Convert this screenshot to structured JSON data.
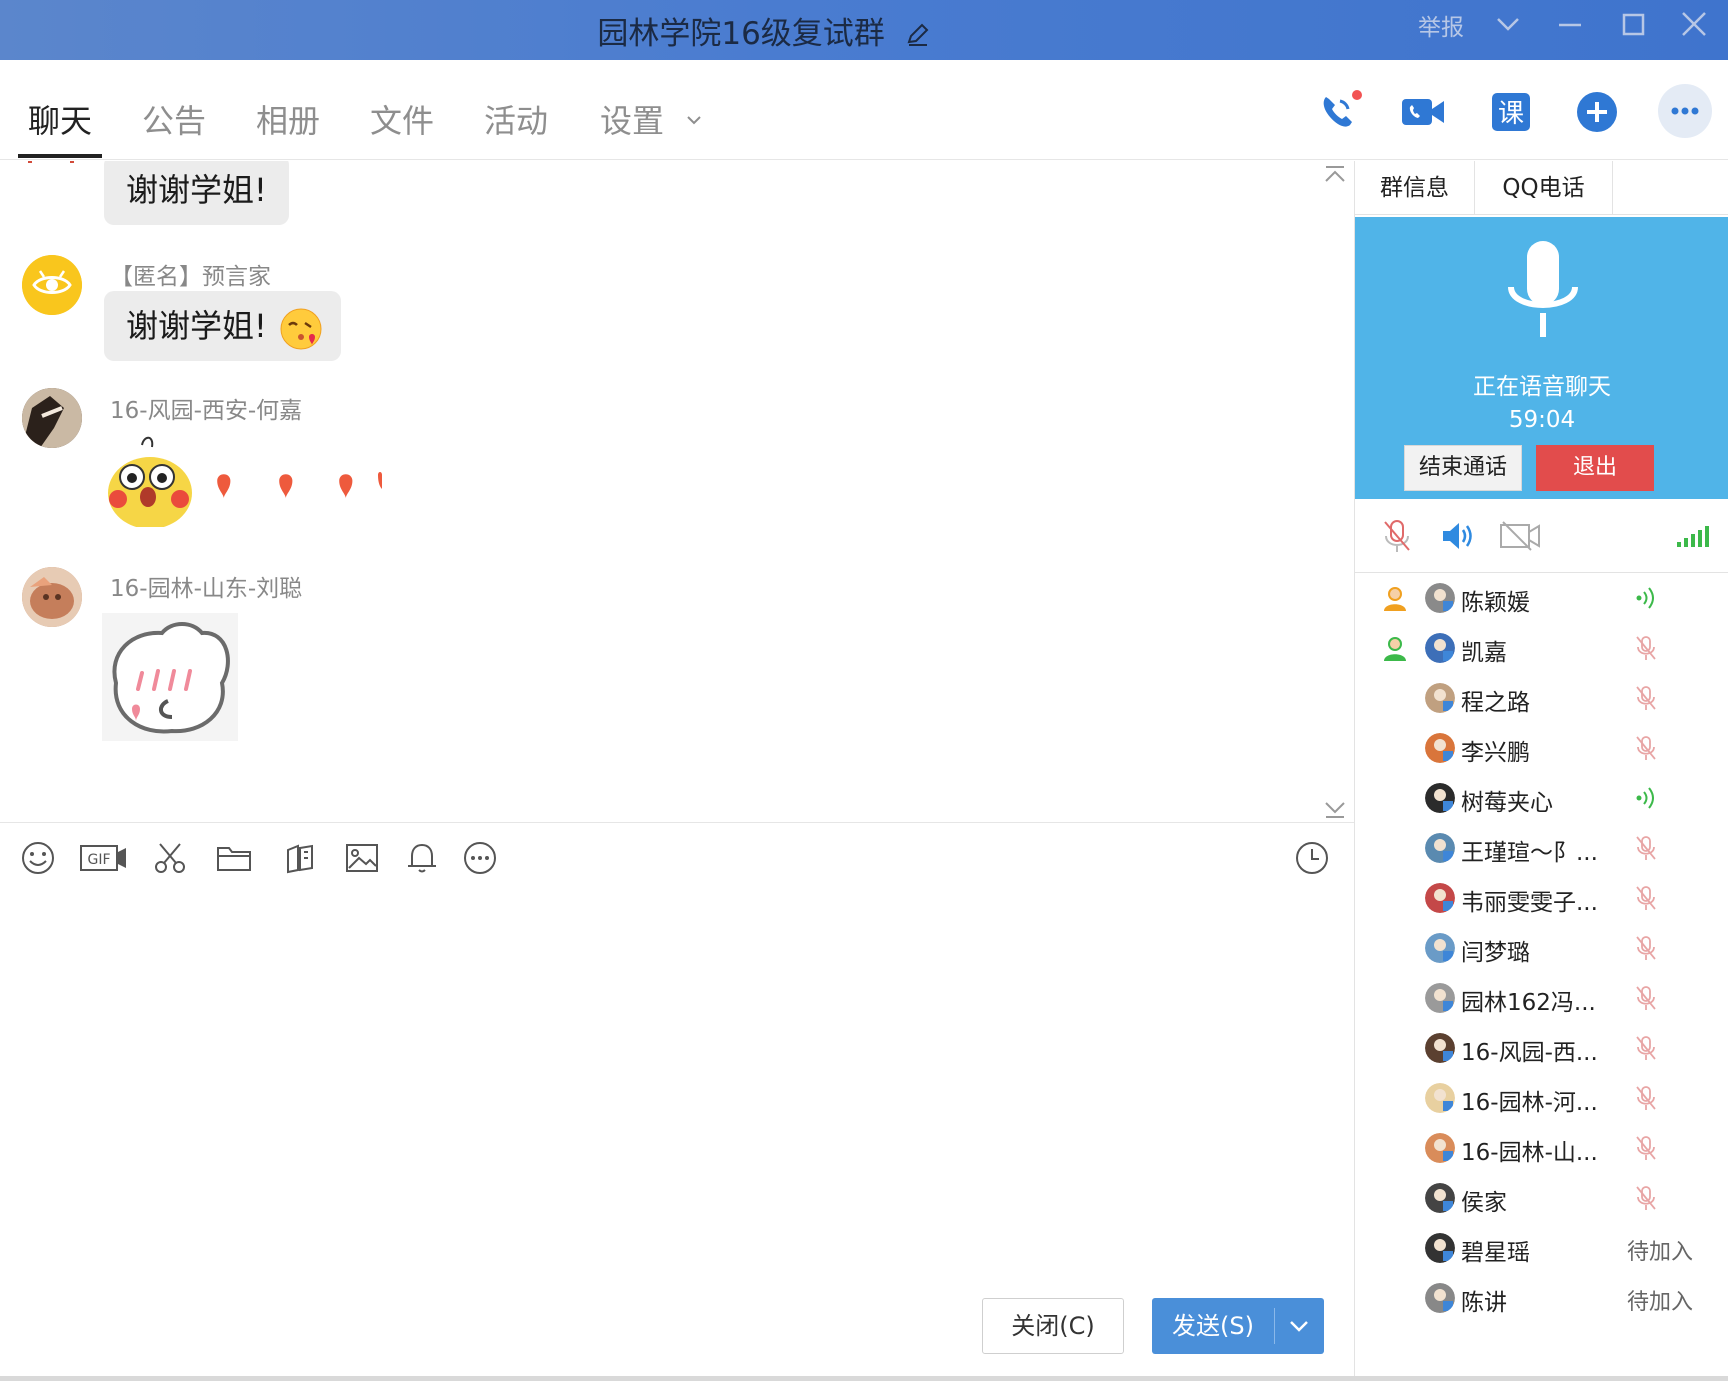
{
  "window": {
    "title": "园林学院16级复试群",
    "report": "举报"
  },
  "tabs": [
    {
      "label": "聊天"
    },
    {
      "label": "公告"
    },
    {
      "label": "相册"
    },
    {
      "label": "文件"
    },
    {
      "label": "活动"
    },
    {
      "label": "设置"
    }
  ],
  "chat": {
    "messages": [
      {
        "sender": "",
        "text": "谢谢学姐!"
      },
      {
        "sender": "【匿名】预言家",
        "text": "谢谢学姐!"
      },
      {
        "sender": "16-风园-西安-何嘉",
        "text": ""
      },
      {
        "sender": "16-园林-山东-刘聪",
        "text": ""
      }
    ]
  },
  "input": {
    "close_label": "关闭(C)",
    "send_label": "发送(S)"
  },
  "side": {
    "tabs": [
      {
        "label": "群信息"
      },
      {
        "label": "QQ电话"
      }
    ],
    "call": {
      "status": "正在语音聊天",
      "time": "59:04",
      "end_label": "结束通话",
      "exit_label": "退出"
    },
    "members": [
      {
        "name": "陈颖媛",
        "admin": true,
        "status": "speaking"
      },
      {
        "name": "凯嘉",
        "admin": true,
        "status": "muted"
      },
      {
        "name": "程之路",
        "admin": false,
        "status": "muted"
      },
      {
        "name": "李兴鹏",
        "admin": false,
        "status": "muted"
      },
      {
        "name": "树莓夹心",
        "admin": false,
        "status": "speaking"
      },
      {
        "name": "王瑾瑄～阝...",
        "admin": false,
        "status": "muted"
      },
      {
        "name": "韦丽雯雯子...",
        "admin": false,
        "status": "muted"
      },
      {
        "name": "闫梦璐",
        "admin": false,
        "status": "muted"
      },
      {
        "name": "园林162冯...",
        "admin": false,
        "status": "muted"
      },
      {
        "name": "16-风园-西...",
        "admin": false,
        "status": "muted"
      },
      {
        "name": "16-园林-河...",
        "admin": false,
        "status": "muted"
      },
      {
        "name": "16-园林-山...",
        "admin": false,
        "status": "muted"
      },
      {
        "name": "侯家",
        "admin": false,
        "status": "muted"
      },
      {
        "name": "碧星瑶",
        "admin": false,
        "status": "waiting",
        "wait_label": "待加入"
      },
      {
        "name": "陈讲",
        "admin": false,
        "status": "waiting",
        "wait_label": "待加入"
      }
    ]
  },
  "colors": {
    "titlebar": "#4a7cd0",
    "accent": "#4a8fd9",
    "call_bg": "#50b4e8",
    "exit_red": "#e24c4c",
    "speaking_green": "#3cb94a"
  }
}
